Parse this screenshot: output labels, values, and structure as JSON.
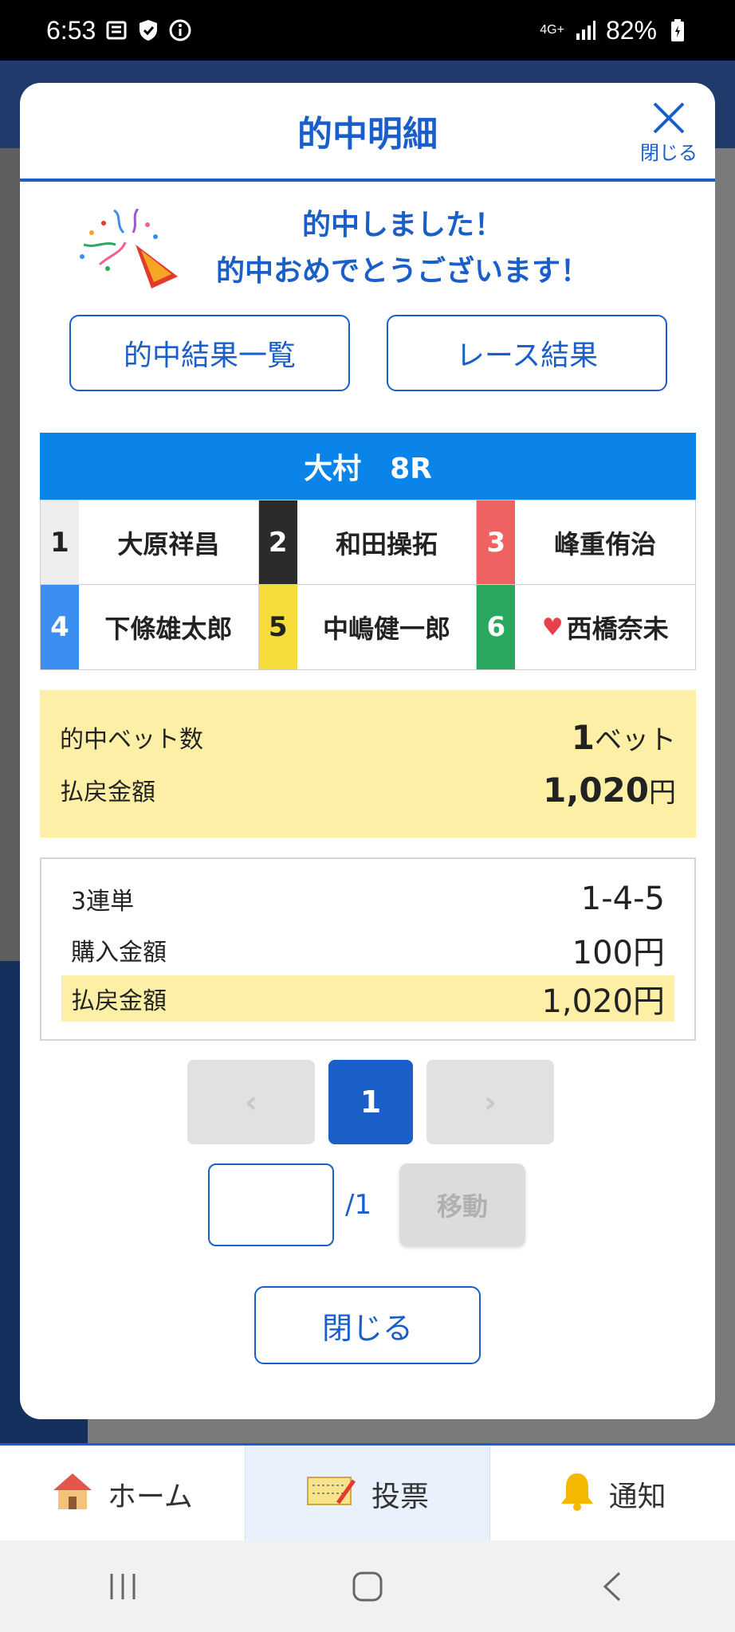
{
  "status_bar": {
    "time": "6:53",
    "network": "4G+",
    "battery": "82%"
  },
  "modal": {
    "title": "的中明細",
    "close_label": "閉じる",
    "congrats_line1": "的中しました！",
    "congrats_line2": "的中おめでとうございます！",
    "buttons": {
      "hit_results": "的中結果一覧",
      "race_results": "レース結果"
    }
  },
  "race": {
    "header": "大村　8R",
    "racers": [
      {
        "num": "1",
        "name": "大原祥昌",
        "num_bg": "#eeeeee",
        "num_color": "#222222",
        "heart": false
      },
      {
        "num": "2",
        "name": "和田操拓",
        "num_bg": "#2b2b2b",
        "num_color": "#ffffff",
        "heart": false
      },
      {
        "num": "3",
        "name": "峰重侑治",
        "num_bg": "#ee6262",
        "num_color": "#ffffff",
        "heart": false
      },
      {
        "num": "4",
        "name": "下條雄太郎",
        "num_bg": "#3b8df0",
        "num_color": "#ffffff",
        "heart": false
      },
      {
        "num": "5",
        "name": "中嶋健一郎",
        "num_bg": "#f6dc3a",
        "num_color": "#222222",
        "heart": false
      },
      {
        "num": "6",
        "name": "西橋奈未",
        "num_bg": "#2aa860",
        "num_color": "#ffffff",
        "heart": true
      }
    ]
  },
  "summary": {
    "bet_count_label": "的中ベット数",
    "bet_count_value": "1",
    "bet_count_unit": "ベット",
    "payout_label": "払戻金額",
    "payout_value": "1,020",
    "payout_unit": "円"
  },
  "detail": {
    "bet_type": "3連単",
    "combination": "1-4-5",
    "purchase_label": "購入金額",
    "purchase_value": "100円",
    "payout_label": "払戻金額",
    "payout_value": "1,020円"
  },
  "pager": {
    "prev": "‹",
    "current": "1",
    "next": "›",
    "input_value": "",
    "total": "/1",
    "go_label": "移動"
  },
  "bottom_close": "閉じる",
  "app_nav": [
    {
      "label": "ホーム",
      "icon": "home-icon"
    },
    {
      "label": "投票",
      "icon": "ticket-icon"
    },
    {
      "label": "通知",
      "icon": "bell-icon"
    }
  ],
  "colors": {
    "accent": "#1a5fc8",
    "race_header": "#0a84e8",
    "highlight": "#fdf0a6"
  }
}
